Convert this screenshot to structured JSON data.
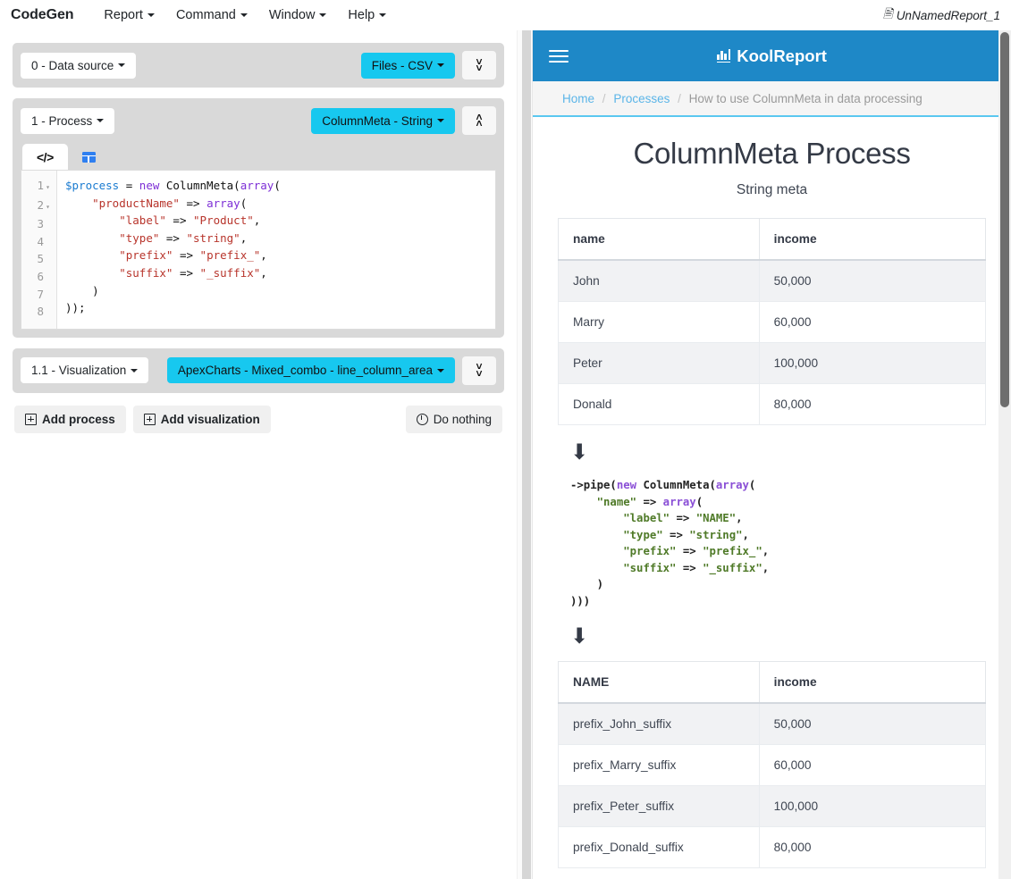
{
  "menubar": {
    "brand": "CodeGen",
    "items": [
      {
        "label": "Report"
      },
      {
        "label": "Command"
      },
      {
        "label": "Window"
      },
      {
        "label": "Help"
      }
    ],
    "report_name": "UnNamedReport_1",
    "report_icon": "document-icon"
  },
  "left_panel": {
    "datasource_block": {
      "index_label": "0 - Data source",
      "type_label": "Files - CSV",
      "toggle_icon": "chevron-double-down-icon"
    },
    "process_block": {
      "index_label": "1 - Process",
      "type_label": "ColumnMeta - String",
      "toggle_icon": "chevron-double-up-icon",
      "tabs": [
        {
          "name": "code-tab",
          "icon": "code-icon",
          "glyph": "</>",
          "active": true
        },
        {
          "name": "table-tab",
          "icon": "table-grid-icon",
          "glyph": "",
          "active": false
        }
      ],
      "code_lines": [
        {
          "n": "1",
          "fold": true,
          "tokens": [
            {
              "t": "var",
              "v": "$process"
            },
            {
              "t": "plain",
              "v": " = "
            },
            {
              "t": "kw",
              "v": "new"
            },
            {
              "t": "plain",
              "v": " ColumnMeta("
            },
            {
              "t": "kw",
              "v": "array"
            },
            {
              "t": "plain",
              "v": "("
            }
          ]
        },
        {
          "n": "2",
          "fold": true,
          "tokens": [
            {
              "t": "plain",
              "v": "    "
            },
            {
              "t": "str",
              "v": "\"productName\""
            },
            {
              "t": "plain",
              "v": " => "
            },
            {
              "t": "kw",
              "v": "array"
            },
            {
              "t": "plain",
              "v": "("
            }
          ]
        },
        {
          "n": "3",
          "fold": false,
          "tokens": [
            {
              "t": "plain",
              "v": "        "
            },
            {
              "t": "str",
              "v": "\"label\""
            },
            {
              "t": "plain",
              "v": " => "
            },
            {
              "t": "str",
              "v": "\"Product\""
            },
            {
              "t": "plain",
              "v": ","
            }
          ]
        },
        {
          "n": "4",
          "fold": false,
          "tokens": [
            {
              "t": "plain",
              "v": "        "
            },
            {
              "t": "str",
              "v": "\"type\""
            },
            {
              "t": "plain",
              "v": " => "
            },
            {
              "t": "str",
              "v": "\"string\""
            },
            {
              "t": "plain",
              "v": ","
            }
          ]
        },
        {
          "n": "5",
          "fold": false,
          "tokens": [
            {
              "t": "plain",
              "v": "        "
            },
            {
              "t": "str",
              "v": "\"prefix\""
            },
            {
              "t": "plain",
              "v": " => "
            },
            {
              "t": "str",
              "v": "\"prefix_\""
            },
            {
              "t": "plain",
              "v": ","
            }
          ]
        },
        {
          "n": "6",
          "fold": false,
          "tokens": [
            {
              "t": "plain",
              "v": "        "
            },
            {
              "t": "str",
              "v": "\"suffix\""
            },
            {
              "t": "plain",
              "v": " => "
            },
            {
              "t": "str",
              "v": "\"_suffix\""
            },
            {
              "t": "plain",
              "v": ","
            }
          ]
        },
        {
          "n": "7",
          "fold": false,
          "tokens": [
            {
              "t": "plain",
              "v": "    )"
            }
          ]
        },
        {
          "n": "8",
          "fold": false,
          "tokens": [
            {
              "t": "plain",
              "v": "));"
            }
          ]
        }
      ]
    },
    "visualization_block": {
      "index_label": "1.1 - Visualization",
      "type_label": "ApexCharts - Mixed_combo - line_column_area",
      "toggle_icon": "chevron-double-down-icon"
    },
    "actions": [
      {
        "name": "add-process-button",
        "label": "Add process",
        "icon": "plus-box-icon"
      },
      {
        "name": "add-visualization-button",
        "label": "Add visualization",
        "icon": "plus-box-icon"
      },
      {
        "name": "do-nothing-button",
        "label": "Do nothing",
        "icon": "clock-icon"
      }
    ]
  },
  "right_panel": {
    "header": {
      "menu_icon": "hamburger-icon",
      "logo_icon": "bar-chart-icon",
      "logo_text": "KoolReport",
      "background_color": "#1e88c7"
    },
    "breadcrumb": {
      "items": [
        {
          "label": "Home",
          "link": true
        },
        {
          "label": "Processes",
          "link": true
        },
        {
          "label": "How to use ColumnMeta in data processing",
          "link": false
        }
      ],
      "separator": "/"
    },
    "title": "ColumnMeta Process",
    "subtitle": "String meta",
    "table_before": {
      "headers": [
        "name",
        "income"
      ],
      "rows": [
        [
          "John",
          "50,000"
        ],
        [
          "Marry",
          "60,000"
        ],
        [
          "Peter",
          "100,000"
        ],
        [
          "Donald",
          "80,000"
        ]
      ]
    },
    "arrow_icon": "arrow-down-icon",
    "code_lines": [
      [
        {
          "t": "plain",
          "v": "->pipe("
        },
        {
          "t": "kw",
          "v": "new"
        },
        {
          "t": "plain",
          "v": " ColumnMeta("
        },
        {
          "t": "kw",
          "v": "array"
        },
        {
          "t": "plain",
          "v": "("
        }
      ],
      [
        {
          "t": "plain",
          "v": "    "
        },
        {
          "t": "str",
          "v": "\"name\""
        },
        {
          "t": "plain",
          "v": " => "
        },
        {
          "t": "kw",
          "v": "array"
        },
        {
          "t": "plain",
          "v": "("
        }
      ],
      [
        {
          "t": "plain",
          "v": "        "
        },
        {
          "t": "str",
          "v": "\"label\""
        },
        {
          "t": "plain",
          "v": " => "
        },
        {
          "t": "str",
          "v": "\"NAME\""
        },
        {
          "t": "plain",
          "v": ","
        }
      ],
      [
        {
          "t": "plain",
          "v": "        "
        },
        {
          "t": "str",
          "v": "\"type\""
        },
        {
          "t": "plain",
          "v": " => "
        },
        {
          "t": "str",
          "v": "\"string\""
        },
        {
          "t": "plain",
          "v": ","
        }
      ],
      [
        {
          "t": "plain",
          "v": "        "
        },
        {
          "t": "str",
          "v": "\"prefix\""
        },
        {
          "t": "plain",
          "v": " => "
        },
        {
          "t": "str",
          "v": "\"prefix_\""
        },
        {
          "t": "plain",
          "v": ","
        }
      ],
      [
        {
          "t": "plain",
          "v": "        "
        },
        {
          "t": "str",
          "v": "\"suffix\""
        },
        {
          "t": "plain",
          "v": " => "
        },
        {
          "t": "str",
          "v": "\"_suffix\""
        },
        {
          "t": "plain",
          "v": ","
        }
      ],
      [
        {
          "t": "plain",
          "v": "    )"
        }
      ],
      [
        {
          "t": "plain",
          "v": ")))"
        }
      ]
    ],
    "table_after": {
      "headers": [
        "NAME",
        "income"
      ],
      "rows": [
        [
          "prefix_John_suffix",
          "50,000"
        ],
        [
          "prefix_Marry_suffix",
          "60,000"
        ],
        [
          "prefix_Peter_suffix",
          "100,000"
        ],
        [
          "prefix_Donald_suffix",
          "80,000"
        ]
      ]
    }
  },
  "colors": {
    "accent_cyan": "#17c8ef",
    "header_blue": "#1e88c7",
    "breadcrumb_link": "#5bb5e8",
    "block_gray": "#d9d9d9"
  }
}
